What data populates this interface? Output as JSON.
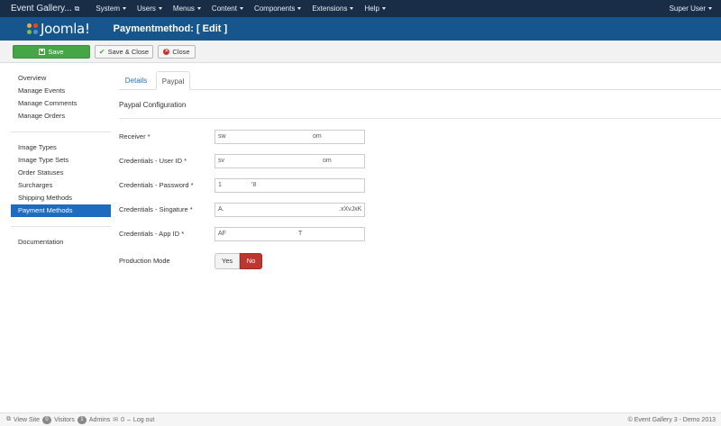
{
  "navbar": {
    "brand": "Event Gallery...",
    "menu": [
      "System",
      "Users",
      "Menus",
      "Content",
      "Components",
      "Extensions",
      "Help"
    ],
    "user": "Super User"
  },
  "header": {
    "logo_text": "Joomla!",
    "title": "Paymentmethod: [ Edit ]"
  },
  "toolbar": {
    "save_label": "Save",
    "save_close_label": "Save & Close",
    "close_label": "Close"
  },
  "sidebar": {
    "group1": [
      "Overview",
      "Manage Events",
      "Manage Comments",
      "Manage Orders"
    ],
    "group2": [
      "Image Types",
      "Image Type Sets",
      "Order Statuses",
      "Surcharges",
      "Shipping Methods",
      "Payment Methods"
    ],
    "group3": [
      "Documentation"
    ],
    "active": "Payment Methods"
  },
  "tabs": [
    "Details",
    "Paypal"
  ],
  "active_tab": "Paypal",
  "section_title": "Paypal Configuration",
  "fields": [
    {
      "label": "Receiver *",
      "value_start": "sw",
      "value_end": "om"
    },
    {
      "label": "Credentials - User ID *",
      "value_start": "sv",
      "value_end": "om"
    },
    {
      "label": "Credentials - Password *",
      "value_start": "1",
      "value_end": "'8"
    },
    {
      "label": "Credentials - Singature *",
      "value_start": "A.",
      "value_end": ".xXvJxK"
    },
    {
      "label": "Credentials - App ID *",
      "value_start": "AF",
      "value_end": "T"
    }
  ],
  "production_mode": {
    "label": "Production Mode",
    "yes_label": "Yes",
    "no_label": "No",
    "selected": "No"
  },
  "statusbar": {
    "view_site": "View Site",
    "visitors_count": "0",
    "visitors_label": "Visitors",
    "admins_count": "1",
    "admins_label": "Admins",
    "messages_count": "0",
    "logout_label": "Log out",
    "copyright": "© Event Gallery 3 - Demo 2013"
  },
  "colors": {
    "navbar": "#1a2d47",
    "header": "#17568c",
    "save_button": "#46a546",
    "active_sidebar": "#1e6cc0",
    "toggle_no": "#bd362f"
  }
}
